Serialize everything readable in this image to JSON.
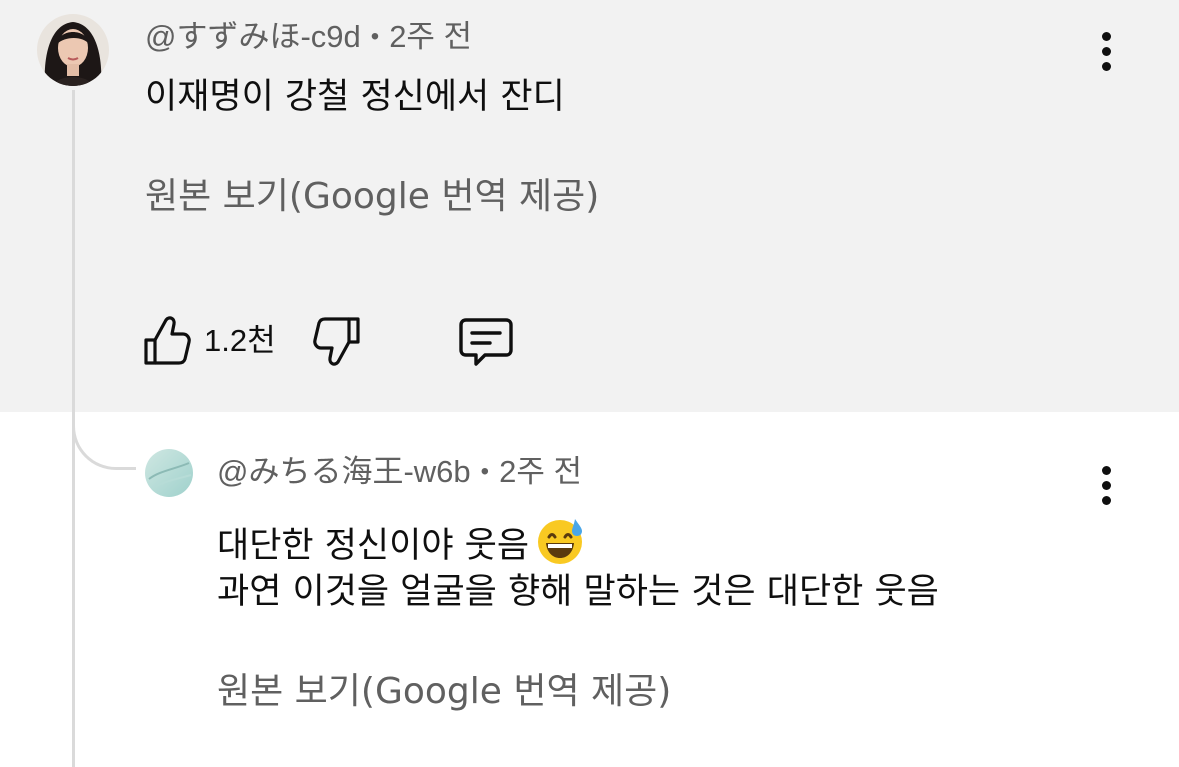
{
  "comment": {
    "author": "@すずみほ-c9d",
    "separator": "•",
    "time": "2주 전",
    "text": "이재명이 강철 정신에서 잔디",
    "original_link": "원본 보기(Google 번역 제공)",
    "likes": "1.2천"
  },
  "reply": {
    "author": "@みちる海王-w6b",
    "separator": "•",
    "time": "2주 전",
    "line1": "대단한 정신이야 웃음",
    "line2": "과연 이것을 얼굴을 향해 말하는 것은 대단한 웃음",
    "original_link": "원본 보기(Google 번역 제공)"
  },
  "icons": {
    "like": "thumbs-up-icon",
    "dislike": "thumbs-down-icon",
    "reply": "reply-comment-icon",
    "more": "more-vertical-icon",
    "emoji": "grinning-face-with-sweat-emoji"
  }
}
